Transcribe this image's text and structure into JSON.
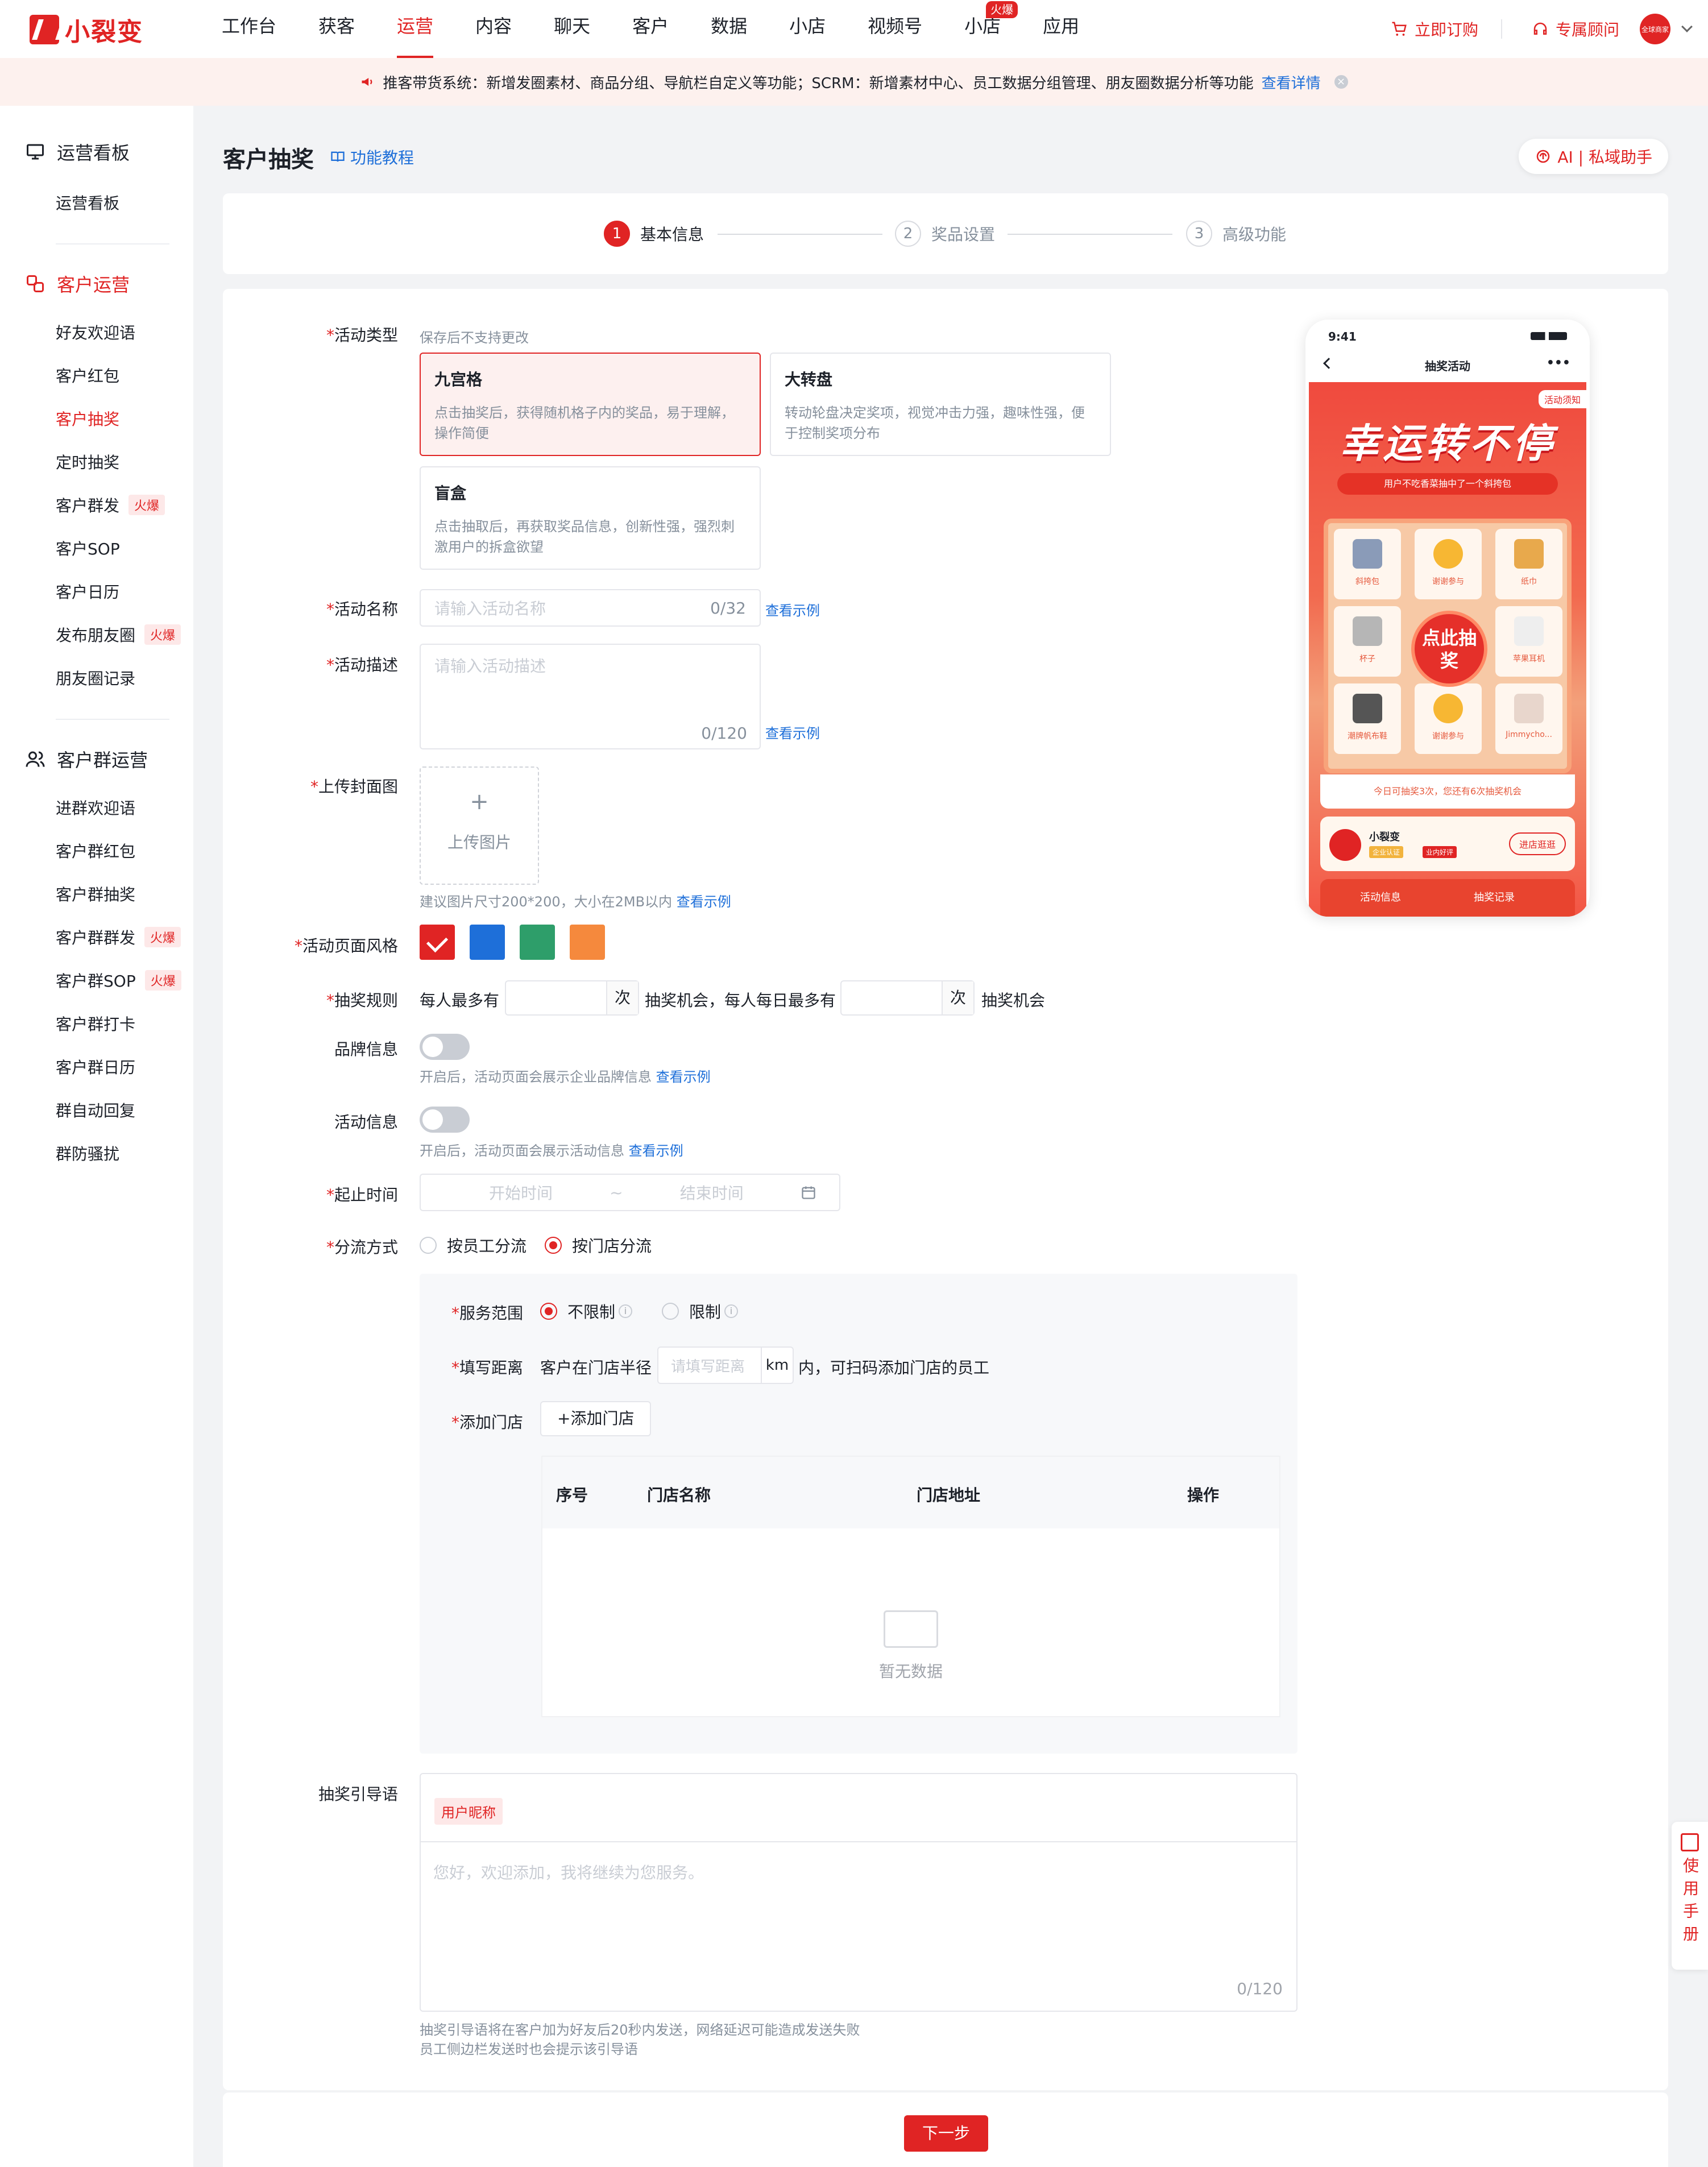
{
  "brand": {
    "logo_text": "小裂变"
  },
  "nav": {
    "items": [
      "工作台",
      "获客",
      "运营",
      "内容",
      "聊天",
      "客户",
      "数据",
      "小店",
      "视频号",
      "小店",
      "应用"
    ],
    "active_index": 2,
    "hot_badge": "火爆"
  },
  "top_right": {
    "subscribe": "立即订购",
    "advisor": "专属顾问",
    "avatar_text": "全球商家"
  },
  "notice": {
    "text": "推客带货系统：新增发圈素材、商品分组、导航栏自定义等功能；SCRM：新增素材中心、员工数据分组管理、朋友圈数据分析等功能",
    "link": "查看详情"
  },
  "sidebar": {
    "groups": [
      {
        "title": "运营看板",
        "items": [
          {
            "label": "运营看板"
          }
        ]
      },
      {
        "title": "客户运营",
        "items": [
          {
            "label": "好友欢迎语"
          },
          {
            "label": "客户红包"
          },
          {
            "label": "客户抽奖"
          },
          {
            "label": "定时抽奖"
          },
          {
            "label": "客户群发",
            "tag": "火爆"
          },
          {
            "label": "客户SOP"
          },
          {
            "label": "客户日历"
          },
          {
            "label": "发布朋友圈",
            "tag": "火爆"
          },
          {
            "label": "朋友圈记录"
          }
        ]
      },
      {
        "title": "客户群运营",
        "items": [
          {
            "label": "进群欢迎语"
          },
          {
            "label": "客户群红包"
          },
          {
            "label": "客户群抽奖"
          },
          {
            "label": "客户群群发",
            "tag": "火爆"
          },
          {
            "label": "客户群SOP",
            "tag": "火爆"
          },
          {
            "label": "客户群打卡"
          },
          {
            "label": "客户群日历"
          },
          {
            "label": "群自动回复"
          },
          {
            "label": "群防骚扰"
          }
        ]
      }
    ]
  },
  "page": {
    "title": "客户抽奖",
    "tutorial": "功能教程",
    "ai_button": "AI | 私域助手"
  },
  "steps": [
    {
      "num": "1",
      "label": "基本信息"
    },
    {
      "num": "2",
      "label": "奖品设置"
    },
    {
      "num": "3",
      "label": "高级功能"
    }
  ],
  "form": {
    "type_label": "活动类型",
    "type_hint": "保存后不支持更改",
    "types": [
      {
        "title": "九宫格",
        "desc": "点击抽奖后，获得随机格子内的奖品，易于理解，操作简便"
      },
      {
        "title": "大转盘",
        "desc": "转动轮盘决定奖项，视觉冲击力强，趣味性强，便于控制奖项分布"
      },
      {
        "title": "盲盒",
        "desc": "点击抽取后，再获取奖品信息，创新性强，强烈刺激用户的拆盒欲望"
      }
    ],
    "name_label": "活动名称",
    "name_placeholder": "请输入活动名称",
    "name_count": "0/32",
    "desc_label": "活动描述",
    "desc_placeholder": "请输入活动描述",
    "desc_count": "0/120",
    "example_link": "查看示例",
    "cover_label": "上传封面图",
    "cover_plus": "+",
    "cover_upload": "上传图片",
    "cover_hint": "建议图片尺寸200*200，大小在2MB以内",
    "style_label": "活动页面风格",
    "style_colors": [
      "#e02424",
      "#1e6fd9",
      "#2e9e6a",
      "#f5893d"
    ],
    "rule_label": "抽奖规则",
    "rule_p1": "每人最多有",
    "rule_unit": "次",
    "rule_p2": "抽奖机会，每人每日最多有",
    "rule_p3": "抽奖机会",
    "brand_label": "品牌信息",
    "brand_hint": "开启后，活动页面会展示企业品牌信息",
    "info_label": "活动信息",
    "info_hint": "开启后，活动页面会展示活动信息",
    "time_label": "起止时间",
    "time_start": "开始时间",
    "time_sep": "~",
    "time_end": "结束时间",
    "split_label": "分流方式",
    "split_opt1": "按员工分流",
    "split_opt2": "按门店分流",
    "scope_label": "服务范围",
    "scope_opt1": "不限制",
    "scope_opt2": "限制",
    "dist_label": "填写距离",
    "dist_p1": "客户在门店半径",
    "dist_placeholder": "请填写距离",
    "dist_unit": "km",
    "dist_p2": "内，可扫码添加门店的员工",
    "store_label": "添加门店",
    "store_button": "+添加门店",
    "table_headers": [
      "序号",
      "门店名称",
      "门店地址",
      "操作"
    ],
    "empty_text": "暂无数据",
    "guide_label": "抽奖引导语",
    "guide_tag": "用户昵称",
    "guide_placeholder": "您好，欢迎添加，我将继续为您服务。",
    "guide_count": "0/120",
    "guide_hint1": "抽奖引导语将在客户加为好友后20秒内发送，网络延迟可能造成发送失败",
    "guide_hint2": "员工侧边栏发送时也会提示该引导语"
  },
  "footer": {
    "next": "下一步"
  },
  "manual": {
    "label": "使用手册"
  },
  "phone": {
    "time": "9:41",
    "title": "抽奖活动",
    "more": "•••",
    "rule_tag": "活动须知",
    "headline": "幸运转不停",
    "marquee": "用户不吃香菜抽中了一个斜挎包",
    "cells": [
      "斜挎包",
      "谢谢参与",
      "纸巾",
      "杯子",
      "苹果耳机",
      "潮牌帆布鞋",
      "谢谢参与",
      "Jimmycho..."
    ],
    "draw_button": "点此抽奖",
    "times_text": "今日可抽奖3次，您还有6次抽奖机会",
    "brand_name": "小裂变",
    "badge1": "企业认证",
    "badge2": "业内好评",
    "visit": "进店逛逛",
    "tab1": "活动信息",
    "tab2": "抽奖记录"
  }
}
